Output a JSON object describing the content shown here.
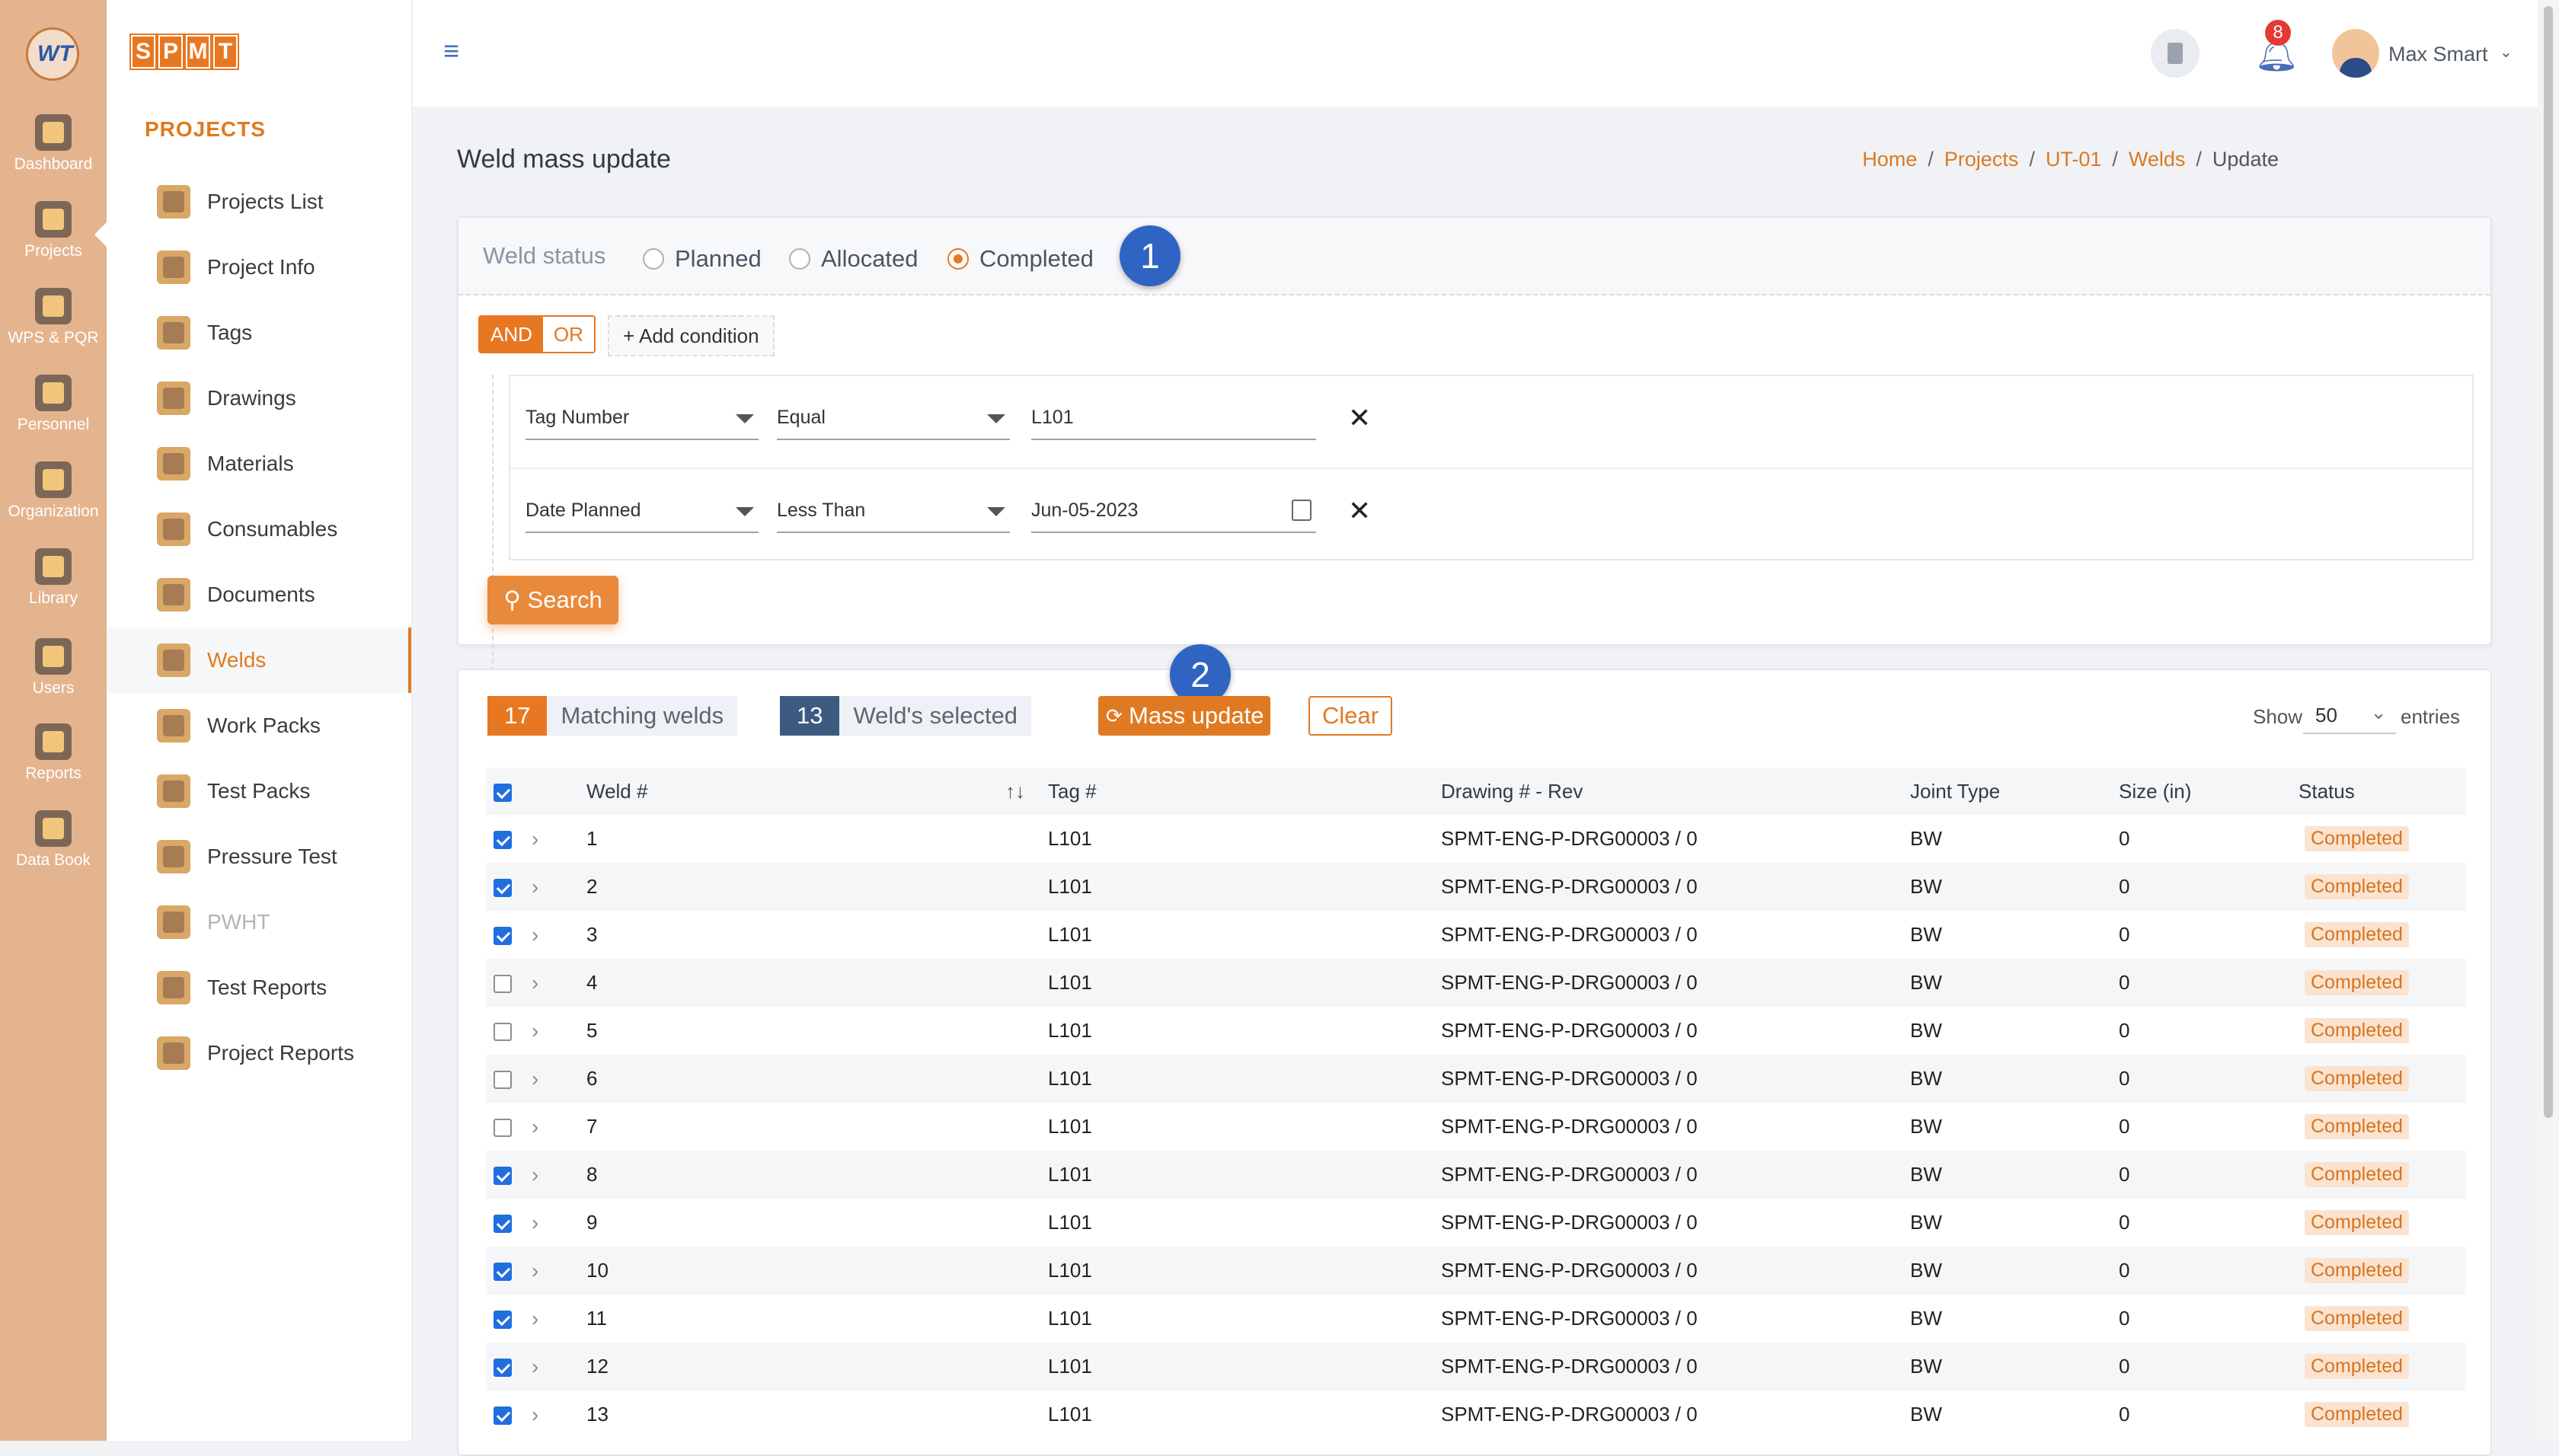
{
  "rail": {
    "logo_text": "WT",
    "items": [
      {
        "label": "Dashboard",
        "icon": "dashboard-icon"
      },
      {
        "label": "Projects",
        "icon": "projects-icon"
      },
      {
        "label": "WPS & PQR",
        "icon": "wps-icon"
      },
      {
        "label": "Personnel",
        "icon": "personnel-icon"
      },
      {
        "label": "Organization",
        "icon": "organization-icon"
      },
      {
        "label": "Library",
        "icon": "library-icon"
      },
      {
        "label": "Users",
        "icon": "users-icon"
      },
      {
        "label": "Reports",
        "icon": "reports-icon"
      },
      {
        "label": "Data Book",
        "icon": "databook-icon"
      }
    ]
  },
  "brand": {
    "letters": [
      "S",
      "P",
      "M",
      "T"
    ]
  },
  "nav": {
    "title": "PROJECTS",
    "items": [
      {
        "label": "Projects List",
        "icon": "projects-list-icon"
      },
      {
        "label": "Project Info",
        "icon": "project-info-icon"
      },
      {
        "label": "Tags",
        "icon": "tags-icon"
      },
      {
        "label": "Drawings",
        "icon": "drawings-icon"
      },
      {
        "label": "Materials",
        "icon": "materials-icon"
      },
      {
        "label": "Consumables",
        "icon": "consumables-icon"
      },
      {
        "label": "Documents",
        "icon": "documents-icon"
      },
      {
        "label": "Welds",
        "icon": "welds-icon",
        "active": true
      },
      {
        "label": "Work Packs",
        "icon": "work-packs-icon"
      },
      {
        "label": "Test Packs",
        "icon": "test-packs-icon"
      },
      {
        "label": "Pressure Test",
        "icon": "pressure-test-icon"
      },
      {
        "label": "PWHT",
        "icon": "pwht-icon",
        "disabled": true
      },
      {
        "label": "Test Reports",
        "icon": "test-reports-icon"
      },
      {
        "label": "Project Reports",
        "icon": "project-reports-icon"
      }
    ]
  },
  "topbar": {
    "notifications": "8",
    "user_name": "Max Smart"
  },
  "page": {
    "title": "Weld mass update",
    "breadcrumb": [
      "Home",
      "Projects",
      "UT-01",
      "Welds",
      "Update"
    ]
  },
  "filter": {
    "status_label": "Weld status",
    "status_options": [
      "Planned",
      "Allocated",
      "Completed"
    ],
    "status_selected": "Completed",
    "step_badge_1": "1",
    "and_label": "AND",
    "or_label": "OR",
    "add_condition_label": "+ Add condition",
    "conditions": [
      {
        "field": "Tag Number",
        "operator": "Equal",
        "value": "L101"
      },
      {
        "field": "Date Planned",
        "operator": "Less Than",
        "value": "Jun-05-2023"
      }
    ],
    "search_label": "Search"
  },
  "results": {
    "matching_count": "17",
    "matching_label": "Matching welds",
    "selected_count": "13",
    "selected_label": "Weld's selected",
    "step_badge_2": "2",
    "mass_update_label": "Mass update",
    "clear_label": "Clear",
    "show_label": "Show",
    "show_value": "50",
    "entries_label": "entries",
    "colors": {
      "matching": "#e87722",
      "selected": "#3d5a80"
    },
    "columns": [
      "Weld #",
      "Tag #",
      "Drawing # - Rev",
      "Joint Type",
      "Size (in)",
      "Status"
    ],
    "rows": [
      {
        "checked": true,
        "weld": "1",
        "tag": "L101",
        "drawing": "SPMT-ENG-P-DRG00003 / 0",
        "joint": "BW",
        "size": "0",
        "status": "Completed"
      },
      {
        "checked": true,
        "weld": "2",
        "tag": "L101",
        "drawing": "SPMT-ENG-P-DRG00003 / 0",
        "joint": "BW",
        "size": "0",
        "status": "Completed"
      },
      {
        "checked": true,
        "weld": "3",
        "tag": "L101",
        "drawing": "SPMT-ENG-P-DRG00003 / 0",
        "joint": "BW",
        "size": "0",
        "status": "Completed"
      },
      {
        "checked": false,
        "weld": "4",
        "tag": "L101",
        "drawing": "SPMT-ENG-P-DRG00003 / 0",
        "joint": "BW",
        "size": "0",
        "status": "Completed"
      },
      {
        "checked": false,
        "weld": "5",
        "tag": "L101",
        "drawing": "SPMT-ENG-P-DRG00003 / 0",
        "joint": "BW",
        "size": "0",
        "status": "Completed"
      },
      {
        "checked": false,
        "weld": "6",
        "tag": "L101",
        "drawing": "SPMT-ENG-P-DRG00003 / 0",
        "joint": "BW",
        "size": "0",
        "status": "Completed"
      },
      {
        "checked": false,
        "weld": "7",
        "tag": "L101",
        "drawing": "SPMT-ENG-P-DRG00003 / 0",
        "joint": "BW",
        "size": "0",
        "status": "Completed"
      },
      {
        "checked": true,
        "weld": "8",
        "tag": "L101",
        "drawing": "SPMT-ENG-P-DRG00003 / 0",
        "joint": "BW",
        "size": "0",
        "status": "Completed"
      },
      {
        "checked": true,
        "weld": "9",
        "tag": "L101",
        "drawing": "SPMT-ENG-P-DRG00003 / 0",
        "joint": "BW",
        "size": "0",
        "status": "Completed"
      },
      {
        "checked": true,
        "weld": "10",
        "tag": "L101",
        "drawing": "SPMT-ENG-P-DRG00003 / 0",
        "joint": "BW",
        "size": "0",
        "status": "Completed"
      },
      {
        "checked": true,
        "weld": "11",
        "tag": "L101",
        "drawing": "SPMT-ENG-P-DRG00003 / 0",
        "joint": "BW",
        "size": "0",
        "status": "Completed"
      },
      {
        "checked": true,
        "weld": "12",
        "tag": "L101",
        "drawing": "SPMT-ENG-P-DRG00003 / 0",
        "joint": "BW",
        "size": "0",
        "status": "Completed"
      },
      {
        "checked": true,
        "weld": "13",
        "tag": "L101",
        "drawing": "SPMT-ENG-P-DRG00003 / 0",
        "joint": "BW",
        "size": "0",
        "status": "Completed"
      }
    ]
  }
}
